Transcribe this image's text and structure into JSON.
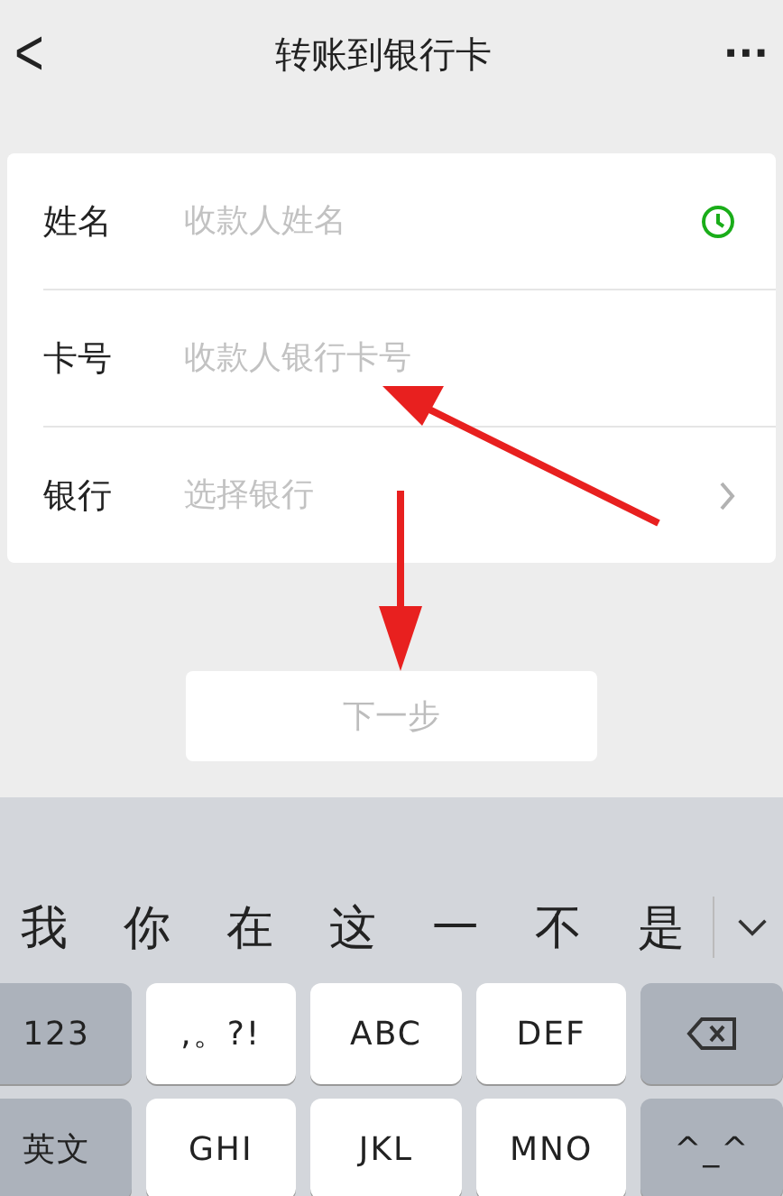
{
  "header": {
    "back": "<",
    "title": "转账到银行卡",
    "more": "···"
  },
  "form": [
    {
      "label": "姓名",
      "placeholder": "收款人姓名",
      "kind": "contact"
    },
    {
      "label": "卡号",
      "placeholder": "收款人银行卡号",
      "kind": "plain"
    },
    {
      "label": "银行",
      "placeholder": "选择银行",
      "kind": "select"
    }
  ],
  "next_button": {
    "label": "下一步",
    "disabled": true
  },
  "keyboard": {
    "candidates": [
      "我",
      "你",
      "在",
      "这",
      "一",
      "不",
      "是"
    ],
    "rows": [
      [
        {
          "label": "123",
          "kind": "function"
        },
        {
          "label": ",。?!",
          "kind": "key"
        },
        {
          "label": "ABC",
          "kind": "key"
        },
        {
          "label": "DEF",
          "kind": "key"
        },
        {
          "kind": "delete"
        }
      ],
      [
        {
          "label": "英文",
          "kind": "function"
        },
        {
          "label": "GHI",
          "kind": "key"
        },
        {
          "label": "JKL",
          "kind": "key"
        },
        {
          "label": "MNO",
          "kind": "key"
        },
        {
          "label": "^_^",
          "kind": "function"
        }
      ]
    ]
  }
}
